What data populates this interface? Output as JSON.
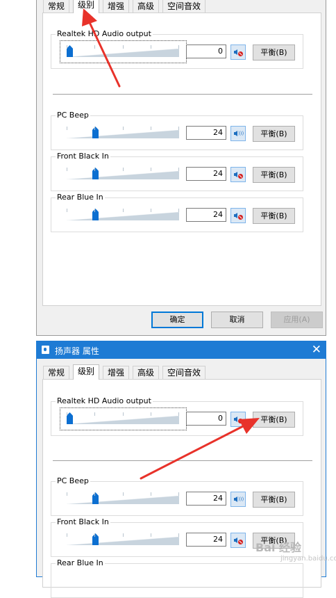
{
  "window1": {
    "tabs": [
      "常规",
      "级别",
      "增强",
      "高级",
      "空间音效"
    ],
    "active_tab": 1,
    "master": {
      "label": "Realtek HD Audio output",
      "level": "0",
      "muted": true,
      "balance_label": "平衡(B)",
      "slider_fraction": 0.0
    },
    "devices": [
      {
        "label": "PC Beep",
        "level": "24",
        "muted": false,
        "balance_label": "平衡(B)",
        "slider_fraction": 0.24
      },
      {
        "label": "Front Black In",
        "level": "24",
        "muted": true,
        "balance_label": "平衡(B)",
        "slider_fraction": 0.24
      },
      {
        "label": "Rear Blue In",
        "level": "24",
        "muted": true,
        "balance_label": "平衡(B)",
        "slider_fraction": 0.24
      }
    ],
    "buttons": {
      "ok": "确定",
      "cancel": "取消",
      "apply": "应用(A)"
    }
  },
  "window2": {
    "title": "扬声器 属性",
    "close_glyph": "✕",
    "tabs": [
      "常规",
      "级别",
      "增强",
      "高级",
      "空间音效"
    ],
    "active_tab": 1,
    "master": {
      "label": "Realtek HD Audio output",
      "level": "0",
      "muted": true,
      "balance_label": "平衡(B)",
      "slider_fraction": 0.0
    },
    "devices": [
      {
        "label": "PC Beep",
        "level": "24",
        "muted": false,
        "balance_label": "平衡(B)",
        "slider_fraction": 0.24
      },
      {
        "label": "Front Black In",
        "level": "24",
        "muted": true,
        "balance_label": "平衡(B)",
        "slider_fraction": 0.24
      },
      {
        "label": "Rear Blue In"
      }
    ]
  },
  "watermark": {
    "text": "Bai 经验",
    "sub": "jingyan.baidu.com"
  },
  "colors": {
    "accent": "#1e7bd4",
    "slider_thumb": "#0c6fd1",
    "annotation_arrow": "#e8322a"
  }
}
